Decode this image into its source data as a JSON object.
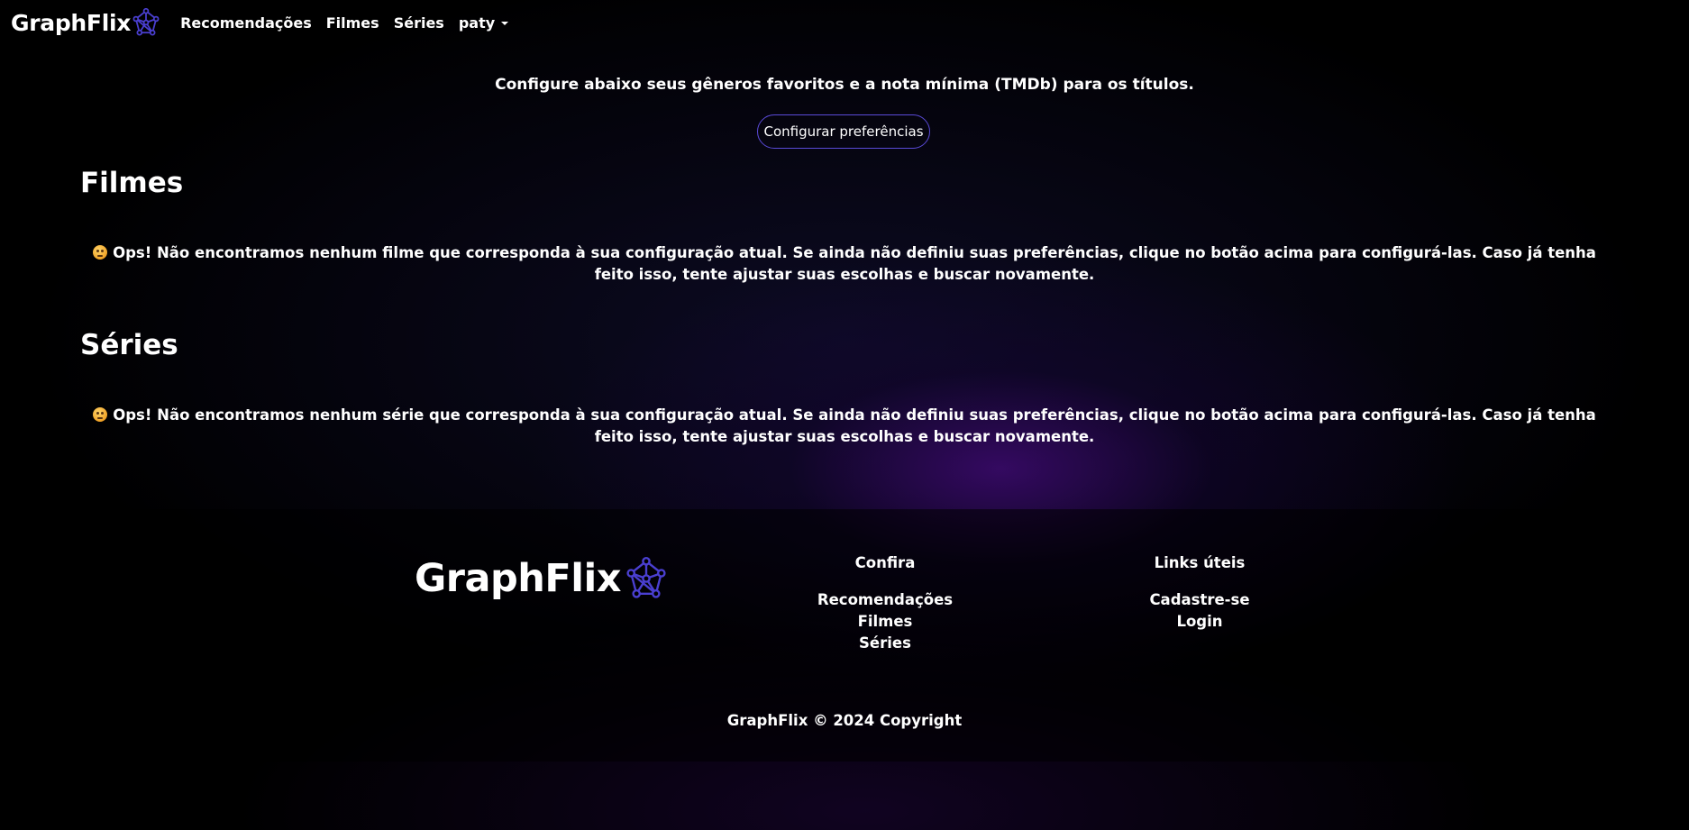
{
  "nav": {
    "brand": "GraphFlix",
    "links": [
      "Recomendações",
      "Filmes",
      "Séries"
    ],
    "user": "paty"
  },
  "prefs": {
    "text": "Configure abaixo seus gêneros favoritos e a nota mínima (TMDb) para os títulos.",
    "button": "Configurar preferências"
  },
  "sections": {
    "movies": {
      "title": "Filmes",
      "message": "Ops! Não encontramos nenhum filme que corresponda à sua configuração atual. Se ainda não definiu suas preferências, clique no botão acima para configurá-las. Caso já tenha feito isso, tente ajustar suas escolhas e buscar novamente."
    },
    "series": {
      "title": "Séries",
      "message": "Ops! Não encontramos nenhum série que corresponda à sua configuração atual. Se ainda não definiu suas preferências, clique no botão acima para configurá-las. Caso já tenha feito isso, tente ajustar suas escolhas e buscar novamente."
    }
  },
  "footer": {
    "brand": "GraphFlix",
    "columns": [
      {
        "title": "Confira",
        "links": [
          "Recomendações",
          "Filmes",
          "Séries"
        ]
      },
      {
        "title": "Links úteis",
        "links": [
          "Cadastre-se",
          "Login"
        ]
      }
    ],
    "copyright": "GraphFlix © 2024 Copyright"
  },
  "colors": {
    "accent": "#5a4ad8",
    "background": "#000000",
    "glow": "#3c0a6e"
  },
  "icons": {
    "logo": "network-graph-icon",
    "empty_state": "worried-face-emoji-icon",
    "dropdown": "caret-down-icon"
  }
}
